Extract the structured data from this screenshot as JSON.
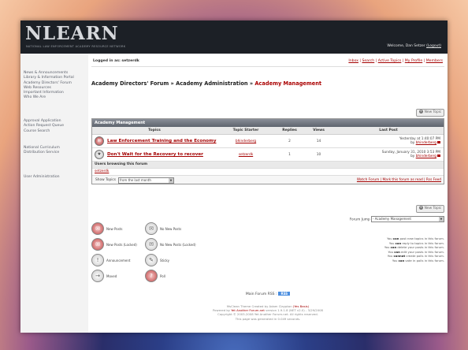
{
  "header": {
    "logo": "NLEARN",
    "logo_tagline": "NATIONAL LAW ENFORCEMENT ACADEMY RESOURCE NETWORK",
    "welcome": "Welcome, Dan Setzer",
    "logout": "(Logout)"
  },
  "sidebar": {
    "group1": [
      "News & Announcements",
      "Library & Information Portal",
      "Academy Directors' Forum",
      "Web Resources",
      "Important Information",
      "Who We Are"
    ],
    "group2": [
      "Approval Application",
      "Action Request Queue",
      "Course Search"
    ],
    "group3": [
      "National Curriculum",
      "Distribution Service"
    ],
    "group4": [
      "User Administration"
    ]
  },
  "topbar": {
    "logged_in": "Logged in as: setzerdk",
    "links": [
      "Inbox",
      "Search",
      "Active Topics",
      "My Profile",
      "Members"
    ]
  },
  "breadcrumb": {
    "part1": "Academy Directors' Forum",
    "sep": " » ",
    "part2": "Academy Administration",
    "current": "Academy Management"
  },
  "new_topic_label": "New Topic",
  "forum": {
    "title": "Academy Management",
    "columns": [
      "Topics",
      "Topic Starter",
      "Replies",
      "Views",
      "Last Post"
    ],
    "topics": [
      {
        "title": "Law Enforcement Training and the Economy",
        "starter": "bhinderberg",
        "replies": "2",
        "views": "14",
        "last_date": "Yesterday at 1:40:07 PM",
        "last_by_prefix": "by ",
        "last_by": "bhinderberg"
      },
      {
        "title": "Don't Wait for the Recovery to recover",
        "starter": "setzerdk",
        "replies": "1",
        "views": "10",
        "last_date": "Sunday, January 31, 2010 3:53 PM",
        "last_by_prefix": "by ",
        "last_by": "bhinderberg"
      }
    ],
    "users_browsing_label": "Users browsing this forum",
    "users_browsing": "setzerdk",
    "show_topics_label": "Show Topics",
    "show_topics_value": "from the last month",
    "footer_links": "Watch Forum | Mark this forum as read | Rss Feed"
  },
  "forum_jump": {
    "label": "Forum Jump",
    "value": "- Academy Management"
  },
  "legend": [
    {
      "label": "New Posts",
      "icon": "new-posts-icon",
      "red": true
    },
    {
      "label": "No New Posts",
      "icon": "no-new-posts-icon",
      "red": false
    },
    {
      "label": "New Posts (Locked)",
      "icon": "new-posts-locked-icon",
      "red": true
    },
    {
      "label": "No New Posts (Locked)",
      "icon": "no-new-posts-locked-icon",
      "red": false
    },
    {
      "label": "Announcement",
      "icon": "announcement-icon",
      "red": false
    },
    {
      "label": "Sticky",
      "icon": "sticky-icon",
      "red": false
    },
    {
      "label": "Moved",
      "icon": "moved-icon",
      "red": false
    },
    {
      "label": "Poll",
      "icon": "poll-icon",
      "red": false
    }
  ],
  "permissions": [
    {
      "pre": "You ",
      "verb": "can",
      "post": " post new topics in this forum."
    },
    {
      "pre": "You ",
      "verb": "can",
      "post": " reply to topics in this forum."
    },
    {
      "pre": "You ",
      "verb": "can",
      "post": " delete your posts in this forum."
    },
    {
      "pre": "You ",
      "verb": "can",
      "post": " edit your posts in this forum."
    },
    {
      "pre": "You ",
      "verb": "cannot",
      "post": " create polls in this forum."
    },
    {
      "pre": "You ",
      "verb": "can",
      "post": " vote in polls in this forum."
    }
  ],
  "rss": {
    "label": "Main Forum RSS :",
    "badge": "RSS"
  },
  "footer": {
    "line1_pre": "MsClean Theme Created by Adam Claypton ",
    "line1_link": "(Yes Basis)",
    "line2_pre": "Powered by ",
    "line2_link": "Yet Another Forum.net",
    "line2_post": " version 1.9.1.8 (NET v2.0) - 3/29/2008",
    "line3": "Copyright © 2003-2008 Yet Another Forum.net. All rights reserved.",
    "line4": "This page was generated in 0.049 seconds."
  },
  "colors": {
    "link_red": "#a40000",
    "header_dark": "#1c2026"
  }
}
